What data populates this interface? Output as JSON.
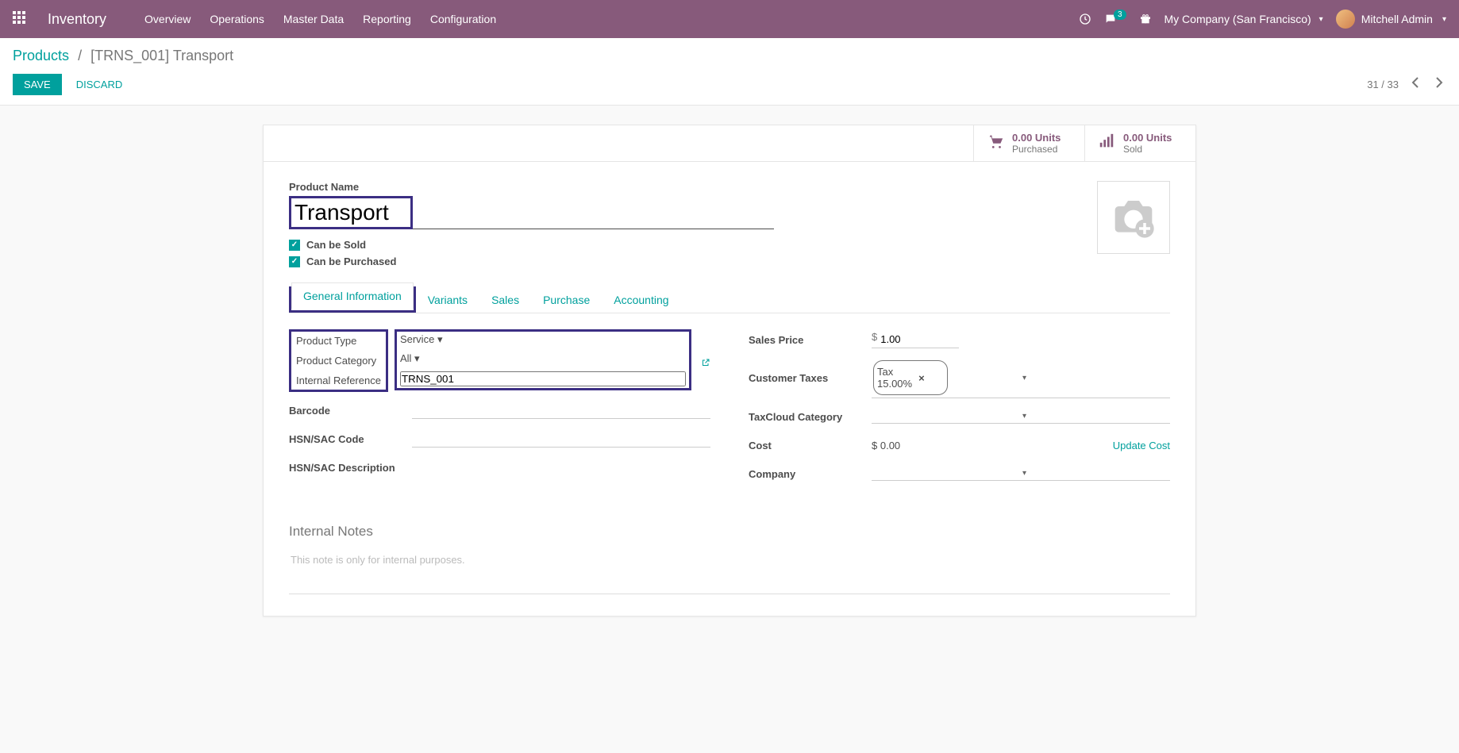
{
  "navbar": {
    "brand": "Inventory",
    "menu": [
      "Overview",
      "Operations",
      "Master Data",
      "Reporting",
      "Configuration"
    ],
    "messages_count": "3",
    "company": "My Company (San Francisco)",
    "user_name": "Mitchell Admin"
  },
  "breadcrumb": {
    "parent": "Products",
    "current": "[TRNS_001] Transport"
  },
  "buttons": {
    "save": "SAVE",
    "discard": "DISCARD"
  },
  "pager": {
    "text": "31 / 33"
  },
  "stats": {
    "purchased_value": "0.00 Units",
    "purchased_label": "Purchased",
    "sold_value": "0.00 Units",
    "sold_label": "Sold"
  },
  "form": {
    "product_name_label": "Product Name",
    "product_name": "Transport",
    "can_be_sold": "Can be Sold",
    "can_be_purchased": "Can be Purchased"
  },
  "tabs": [
    "General Information",
    "Variants",
    "Sales",
    "Purchase",
    "Accounting"
  ],
  "general": {
    "left": {
      "product_type_label": "Product Type",
      "product_type": "Service",
      "product_category_label": "Product Category",
      "product_category": "All",
      "internal_reference_label": "Internal Reference",
      "internal_reference": "TRNS_001",
      "barcode_label": "Barcode",
      "barcode": "",
      "hsn_label": "HSN/SAC Code",
      "hsn": "",
      "hsn_desc_label": "HSN/SAC Description",
      "hsn_desc": ""
    },
    "right": {
      "sales_price_label": "Sales Price",
      "sales_price_currency": "$",
      "sales_price": "1.00",
      "customer_taxes_label": "Customer Taxes",
      "customer_tax_tag": "Tax 15.00%",
      "taxcloud_label": "TaxCloud Category",
      "taxcloud": "",
      "cost_label": "Cost",
      "cost_currency": "$",
      "cost": "0.00",
      "update_cost": "Update Cost",
      "company_label": "Company",
      "company": ""
    }
  },
  "notes": {
    "title": "Internal Notes",
    "placeholder": "This note is only for internal purposes."
  }
}
